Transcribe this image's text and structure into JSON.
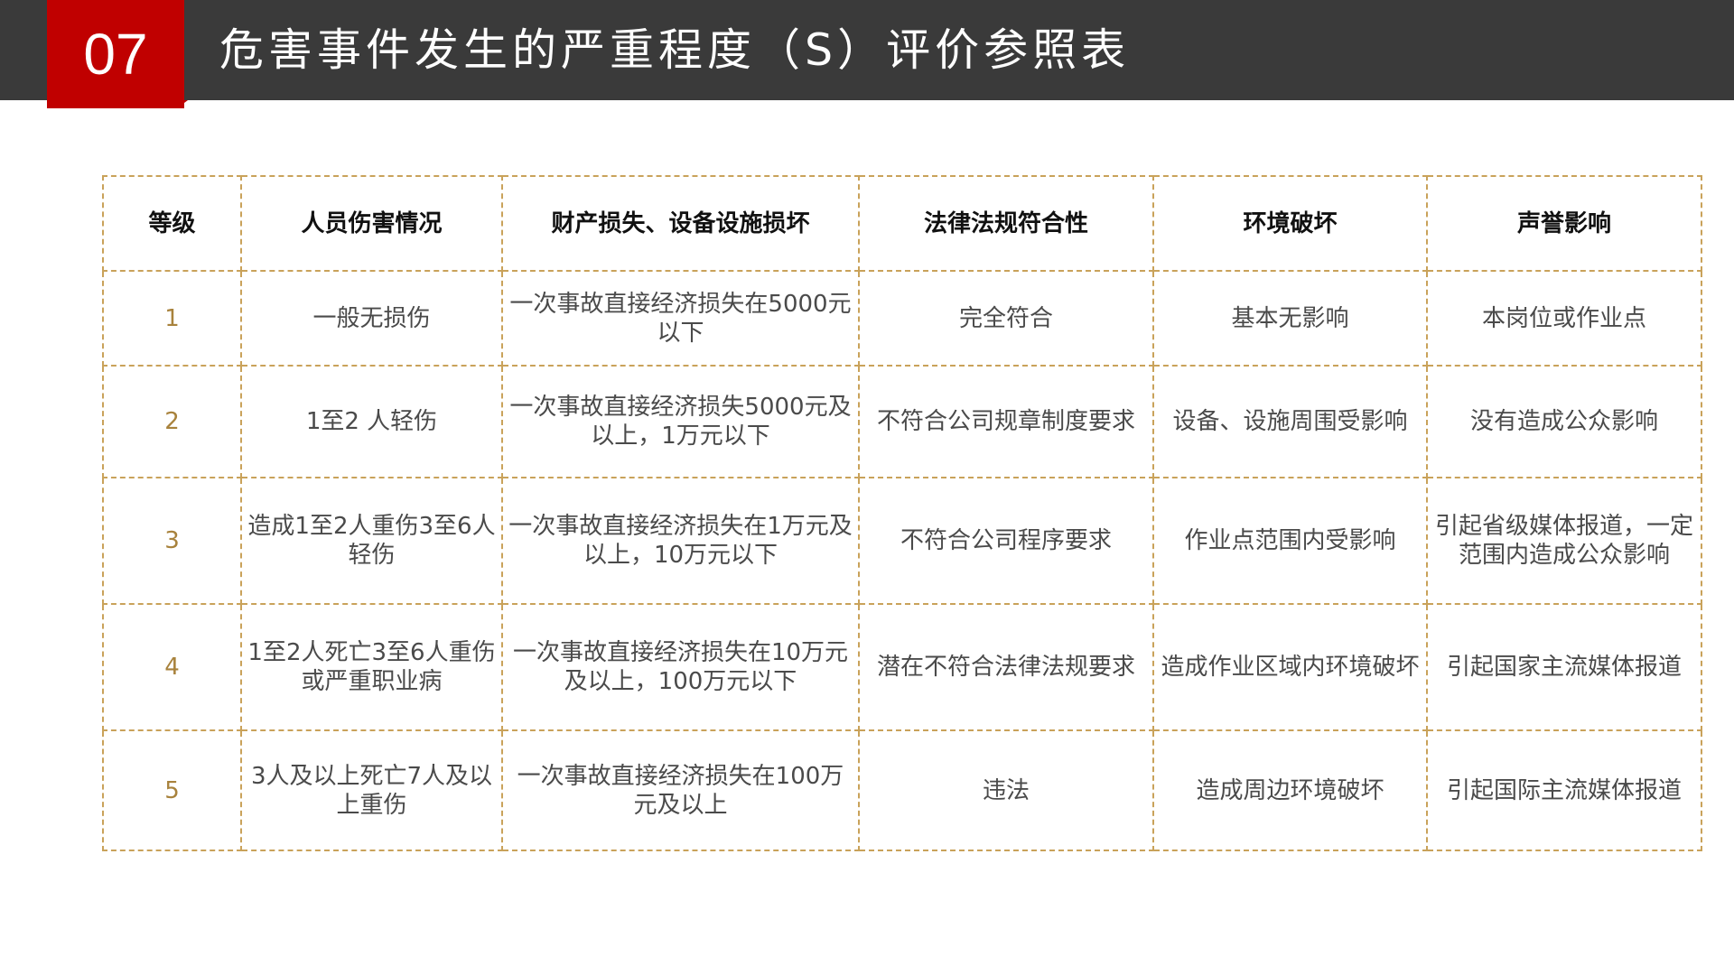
{
  "header": {
    "number": "07",
    "title": "危害事件发生的严重程度（S）评价参照表"
  },
  "colors": {
    "header_bg": "#3a3a3a",
    "badge_bg": "#c00000",
    "border": "#c9a25a",
    "level_text": "#a8823c"
  },
  "table": {
    "headers": [
      "等级",
      "人员伤害情况",
      "财产损失、设备设施损坏",
      "法律法规符合性",
      "环境破坏",
      "声誉影响"
    ],
    "rows": [
      [
        "1",
        "一般无损伤",
        "一次事故直接经济损失在5000元以下",
        "完全符合",
        "基本无影响",
        "本岗位或作业点"
      ],
      [
        "2",
        "1至2 人轻伤",
        "一次事故直接经济损失5000元及以上，1万元以下",
        "不符合公司规章制度要求",
        "设备、设施周围受影响",
        "没有造成公众影响"
      ],
      [
        "3",
        "造成1至2人重伤3至6人轻伤",
        "一次事故直接经济损失在1万元及以上，10万元以下",
        "不符合公司程序要求",
        "作业点范围内受影响",
        "引起省级媒体报道，一定范围内造成公众影响"
      ],
      [
        "4",
        "1至2人死亡3至6人重伤或严重职业病",
        "一次事故直接经济损失在10万元及以上，100万元以下",
        "潜在不符合法律法规要求",
        "造成作业区域内环境破坏",
        "引起国家主流媒体报道"
      ],
      [
        "5",
        "3人及以上死亡7人及以上重伤",
        "一次事故直接经济损失在100万元及以上",
        "违法",
        "造成周边环境破坏",
        "引起国际主流媒体报道"
      ]
    ]
  }
}
